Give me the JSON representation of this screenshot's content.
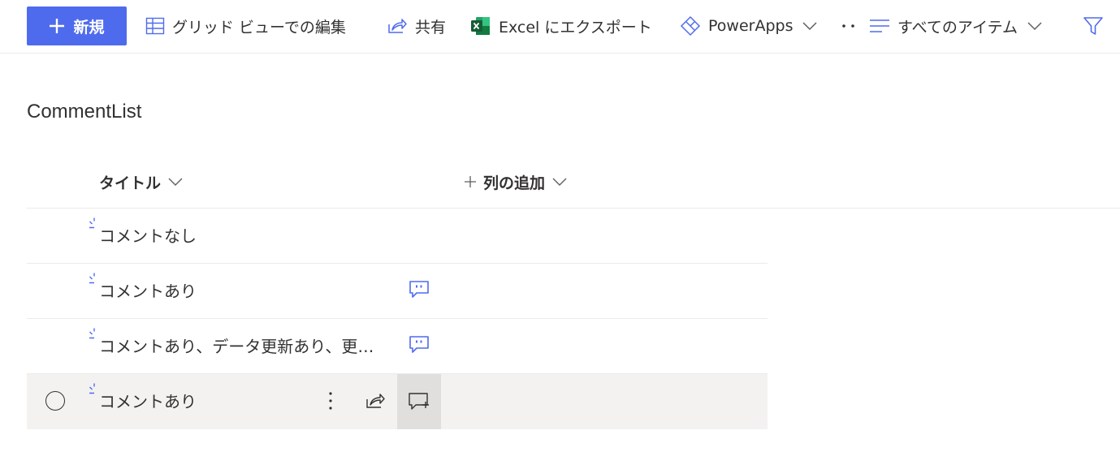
{
  "toolbar": {
    "new_label": "新規",
    "grid_edit_label": "グリッド ビューでの編集",
    "share_label": "共有",
    "export_label": "Excel にエクスポート",
    "powerapps_label": "PowerApps",
    "view_label": "すべてのアイテム",
    "accent_color": "#4f6bed"
  },
  "list": {
    "title": "CommentList",
    "columns": {
      "title_label": "タイトル",
      "add_column_label": "列の追加"
    },
    "rows": [
      {
        "title": "コメントなし",
        "has_comment": false
      },
      {
        "title": "コメントあり",
        "has_comment": true
      },
      {
        "title": "コメントあり、データ更新あり、更…",
        "has_comment": true
      },
      {
        "title": "コメントあり",
        "has_comment": true,
        "selected": true
      }
    ]
  }
}
